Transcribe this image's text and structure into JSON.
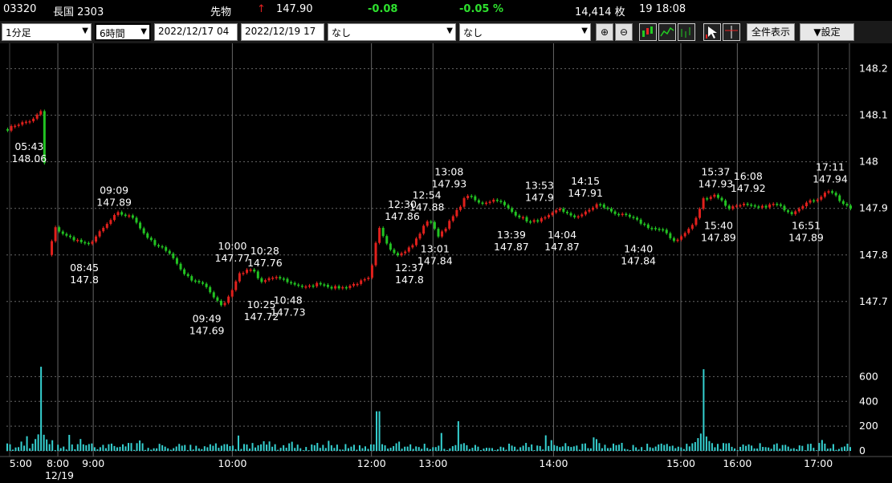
{
  "header": {
    "code": "03320",
    "name": "長国 2303",
    "kind": "先物",
    "arrow": "↑",
    "price": "147.90",
    "change": "-0.08",
    "change_pct": "-0.05 %",
    "volume": "14,414 枚",
    "time": "19 18:08"
  },
  "toolbar": {
    "interval": "1分足",
    "span": "6時間",
    "from": "2022/12/17 04",
    "to": "2022/12/19 17",
    "indicator1": "なし",
    "indicator2": "なし",
    "zoom_in": "⊕",
    "zoom_out": "⊖",
    "show_all": "全件表示",
    "settings": "▼設定"
  },
  "colors": {
    "up": "#e0201c",
    "down": "#22c322",
    "volume": "#35d0d0",
    "grid": "#666666"
  },
  "chart_data": {
    "type": "candlestick",
    "y_ticks": [
      "148.2",
      "148.1",
      "148",
      "147.9",
      "147.8",
      "147.7"
    ],
    "ylim": [
      147.66,
      148.22
    ],
    "volume_ticks": [
      "600",
      "400",
      "200",
      "0"
    ],
    "volume_ylim": [
      0,
      700
    ],
    "x_ticks": [
      "5:00",
      "8:00",
      "9:00",
      "10:00",
      "12:00",
      "13:00",
      "14:00",
      "15:00",
      "16:00",
      "17:00"
    ],
    "date_label": "12/19",
    "annotations": [
      {
        "time": "05:43",
        "value": "148.06",
        "pos": "below"
      },
      {
        "time": "08:45",
        "value": "147.8",
        "pos": "below"
      },
      {
        "time": "09:09",
        "value": "147.89",
        "pos": "above"
      },
      {
        "time": "09:49",
        "value": "147.69",
        "pos": "below"
      },
      {
        "time": "10:00",
        "value": "147.77",
        "pos": "above"
      },
      {
        "time": "10:25",
        "value": "147.72",
        "pos": "below"
      },
      {
        "time": "10:28",
        "value": "147.76",
        "pos": "above"
      },
      {
        "time": "10:48",
        "value": "147.73",
        "pos": "below"
      },
      {
        "time": "12:30",
        "value": "147.86",
        "pos": "above"
      },
      {
        "time": "12:37",
        "value": "147.8",
        "pos": "below"
      },
      {
        "time": "12:54",
        "value": "147.88",
        "pos": "above"
      },
      {
        "time": "13:01",
        "value": "147.84",
        "pos": "below"
      },
      {
        "time": "13:08",
        "value": "147.93",
        "pos": "above"
      },
      {
        "time": "13:39",
        "value": "147.87",
        "pos": "below"
      },
      {
        "time": "13:53",
        "value": "147.9",
        "pos": "above"
      },
      {
        "time": "14:04",
        "value": "147.87",
        "pos": "below"
      },
      {
        "time": "14:15",
        "value": "147.91",
        "pos": "above"
      },
      {
        "time": "14:40",
        "value": "147.84",
        "pos": "below"
      },
      {
        "time": "15:37",
        "value": "147.93",
        "pos": "above"
      },
      {
        "time": "15:40",
        "value": "147.89",
        "pos": "below"
      },
      {
        "time": "16:08",
        "value": "147.92",
        "pos": "above"
      },
      {
        "time": "16:51",
        "value": "147.89",
        "pos": "below"
      },
      {
        "time": "17:11",
        "value": "147.94",
        "pos": "above"
      }
    ],
    "price_path": [
      [
        0.0,
        148.07
      ],
      [
        0.01,
        148.08
      ],
      [
        0.03,
        148.09
      ],
      [
        0.04,
        148.11
      ],
      [
        0.05,
        147.8
      ],
      [
        0.055,
        147.86
      ],
      [
        0.07,
        147.84
      ],
      [
        0.085,
        147.83
      ],
      [
        0.095,
        147.82
      ],
      [
        0.11,
        147.85
      ],
      [
        0.13,
        147.89
      ],
      [
        0.15,
        147.88
      ],
      [
        0.16,
        147.85
      ],
      [
        0.175,
        147.82
      ],
      [
        0.19,
        147.81
      ],
      [
        0.205,
        147.77
      ],
      [
        0.215,
        147.75
      ],
      [
        0.23,
        147.74
      ],
      [
        0.245,
        147.71
      ],
      [
        0.255,
        147.69
      ],
      [
        0.265,
        147.72
      ],
      [
        0.275,
        147.76
      ],
      [
        0.29,
        147.77
      ],
      [
        0.3,
        147.74
      ],
      [
        0.31,
        147.75
      ],
      [
        0.325,
        147.75
      ],
      [
        0.335,
        147.74
      ],
      [
        0.355,
        147.73
      ],
      [
        0.37,
        147.74
      ],
      [
        0.385,
        147.73
      ],
      [
        0.4,
        147.73
      ],
      [
        0.43,
        147.75
      ],
      [
        0.44,
        147.86
      ],
      [
        0.455,
        147.81
      ],
      [
        0.465,
        147.8
      ],
      [
        0.48,
        147.82
      ],
      [
        0.49,
        147.85
      ],
      [
        0.5,
        147.88
      ],
      [
        0.51,
        147.84
      ],
      [
        0.52,
        147.86
      ],
      [
        0.535,
        147.9
      ],
      [
        0.545,
        147.93
      ],
      [
        0.56,
        147.91
      ],
      [
        0.58,
        147.92
      ],
      [
        0.6,
        147.89
      ],
      [
        0.62,
        147.87
      ],
      [
        0.64,
        147.88
      ],
      [
        0.655,
        147.9
      ],
      [
        0.67,
        147.88
      ],
      [
        0.685,
        147.89
      ],
      [
        0.7,
        147.91
      ],
      [
        0.72,
        147.89
      ],
      [
        0.74,
        147.88
      ],
      [
        0.76,
        147.86
      ],
      [
        0.78,
        147.85
      ],
      [
        0.79,
        147.83
      ],
      [
        0.8,
        147.84
      ],
      [
        0.815,
        147.87
      ],
      [
        0.825,
        147.92
      ],
      [
        0.84,
        147.93
      ],
      [
        0.855,
        147.9
      ],
      [
        0.87,
        147.91
      ],
      [
        0.89,
        147.9
      ],
      [
        0.91,
        147.91
      ],
      [
        0.93,
        147.89
      ],
      [
        0.945,
        147.91
      ],
      [
        0.96,
        147.92
      ],
      [
        0.975,
        147.94
      ],
      [
        0.99,
        147.91
      ],
      [
        1.0,
        147.9
      ]
    ],
    "volume_spikes": [
      {
        "x": 0.04,
        "v": 680
      },
      {
        "x": 0.44,
        "v": 320
      },
      {
        "x": 0.535,
        "v": 240
      },
      {
        "x": 0.825,
        "v": 660
      }
    ]
  }
}
